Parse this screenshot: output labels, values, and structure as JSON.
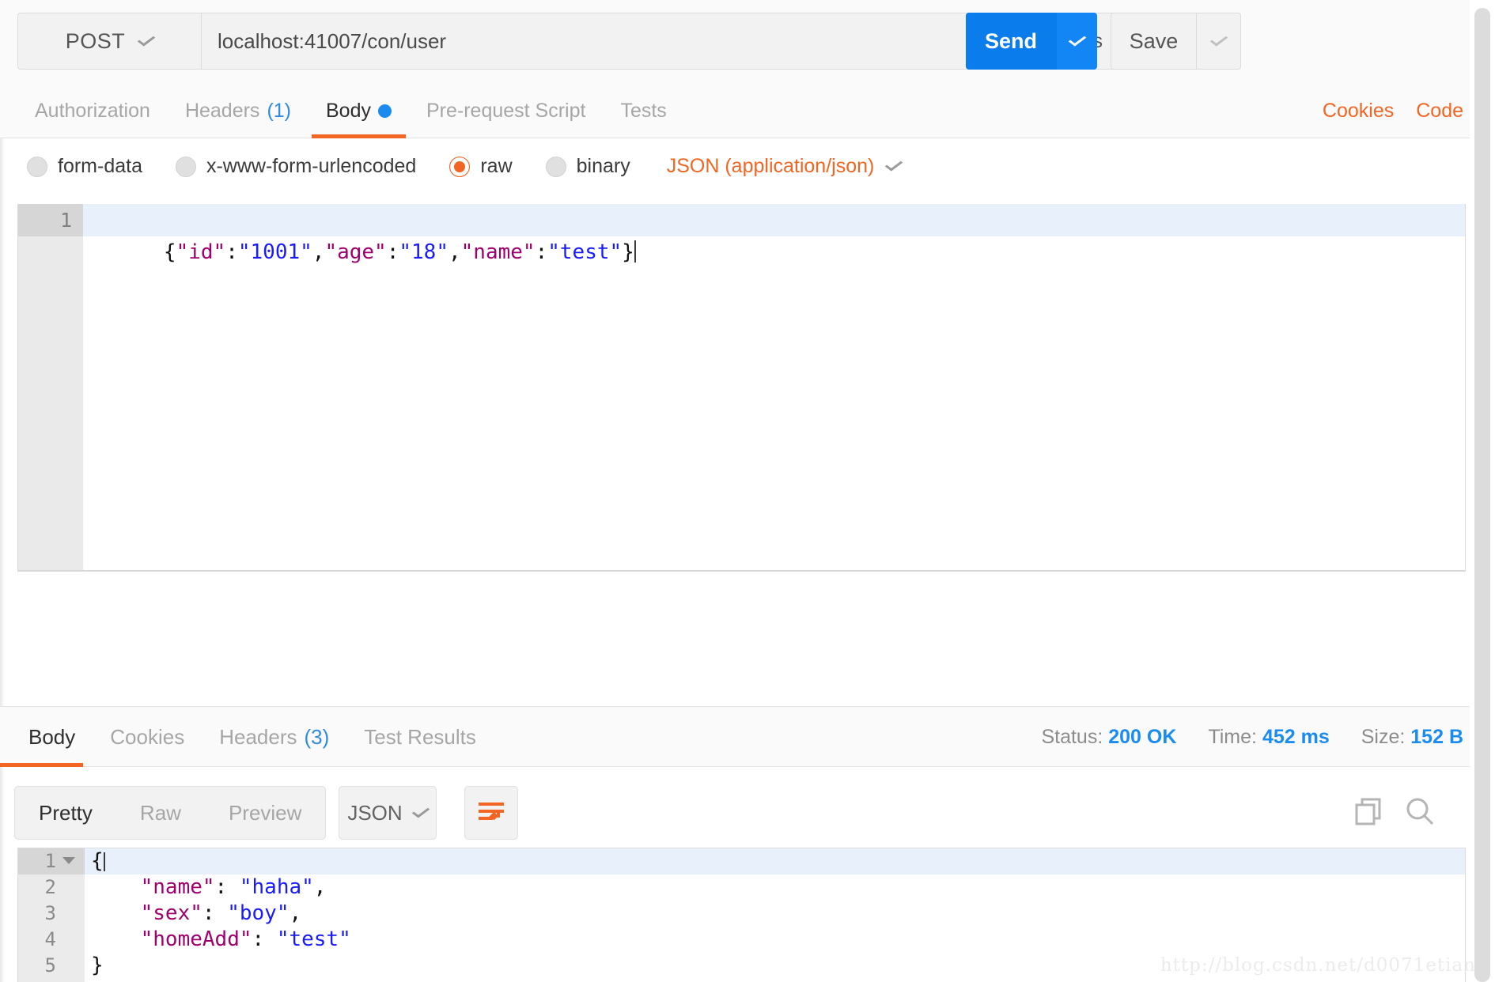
{
  "request_bar": {
    "method": "POST",
    "url": "localhost:41007/con/user",
    "params_label": "Params",
    "send_label": "Send",
    "save_label": "Save"
  },
  "request_tabs": [
    {
      "label": "Authorization",
      "count": "",
      "active": false,
      "dot": false
    },
    {
      "label": "Headers",
      "count": "(1)",
      "active": false,
      "dot": false
    },
    {
      "label": "Body",
      "count": "",
      "active": true,
      "dot": true
    },
    {
      "label": "Pre-request Script",
      "count": "",
      "active": false,
      "dot": false
    },
    {
      "label": "Tests",
      "count": "",
      "active": false,
      "dot": false
    }
  ],
  "header_links": {
    "cookies": "Cookies",
    "code": "Code"
  },
  "body_type_options": [
    {
      "label": "form-data",
      "selected": false
    },
    {
      "label": "x-www-form-urlencoded",
      "selected": false
    },
    {
      "label": "raw",
      "selected": true
    },
    {
      "label": "binary",
      "selected": false
    }
  ],
  "content_type": "JSON (application/json)",
  "request_body": {
    "line_number": "1",
    "raw": "{\"id\":\"1001\",\"age\":\"18\",\"name\":\"test\"}",
    "tokens": [
      {
        "t": "{",
        "k": "punc"
      },
      {
        "t": "\"id\"",
        "k": "key"
      },
      {
        "t": ":",
        "k": "punc"
      },
      {
        "t": "\"1001\"",
        "k": "str"
      },
      {
        "t": ",",
        "k": "punc"
      },
      {
        "t": "\"age\"",
        "k": "key"
      },
      {
        "t": ":",
        "k": "punc"
      },
      {
        "t": "\"18\"",
        "k": "str"
      },
      {
        "t": ",",
        "k": "punc"
      },
      {
        "t": "\"name\"",
        "k": "key"
      },
      {
        "t": ":",
        "k": "punc"
      },
      {
        "t": "\"test\"",
        "k": "str"
      },
      {
        "t": "}",
        "k": "punc"
      }
    ]
  },
  "response_tabs": [
    {
      "label": "Body",
      "count": "",
      "active": true
    },
    {
      "label": "Cookies",
      "count": "",
      "active": false
    },
    {
      "label": "Headers",
      "count": "(3)",
      "active": false
    },
    {
      "label": "Test Results",
      "count": "",
      "active": false
    }
  ],
  "response_meta": {
    "status_label": "Status:",
    "status_value": "200 OK",
    "time_label": "Time:",
    "time_value": "452 ms",
    "size_label": "Size:",
    "size_value": "152 B"
  },
  "response_toolbar": {
    "views": [
      {
        "label": "Pretty",
        "active": true
      },
      {
        "label": "Raw",
        "active": false
      },
      {
        "label": "Preview",
        "active": false
      }
    ],
    "format": "JSON"
  },
  "response_body": {
    "lines": [
      {
        "num": "1",
        "fold": true,
        "active": true,
        "tokens": [
          {
            "t": "{",
            "k": "punc"
          }
        ]
      },
      {
        "num": "2",
        "fold": false,
        "active": false,
        "tokens": [
          {
            "t": "    ",
            "k": "punc"
          },
          {
            "t": "\"name\"",
            "k": "key"
          },
          {
            "t": ": ",
            "k": "punc"
          },
          {
            "t": "\"haha\"",
            "k": "str"
          },
          {
            "t": ",",
            "k": "punc"
          }
        ]
      },
      {
        "num": "3",
        "fold": false,
        "active": false,
        "tokens": [
          {
            "t": "    ",
            "k": "punc"
          },
          {
            "t": "\"sex\"",
            "k": "key"
          },
          {
            "t": ": ",
            "k": "punc"
          },
          {
            "t": "\"boy\"",
            "k": "str"
          },
          {
            "t": ",",
            "k": "punc"
          }
        ]
      },
      {
        "num": "4",
        "fold": false,
        "active": false,
        "tokens": [
          {
            "t": "    ",
            "k": "punc"
          },
          {
            "t": "\"homeAdd\"",
            "k": "key"
          },
          {
            "t": ": ",
            "k": "punc"
          },
          {
            "t": "\"test\"",
            "k": "str"
          }
        ]
      },
      {
        "num": "5",
        "fold": false,
        "active": false,
        "tokens": [
          {
            "t": "}",
            "k": "punc"
          }
        ]
      }
    ]
  },
  "watermark": "http://blog.csdn.net/d0071etian",
  "colors": {
    "accent_orange": "#f26522",
    "accent_blue": "#1a8cf0",
    "send_blue": "#0b7cec",
    "json_key": "#a0006e",
    "json_string": "#1a1aff"
  }
}
